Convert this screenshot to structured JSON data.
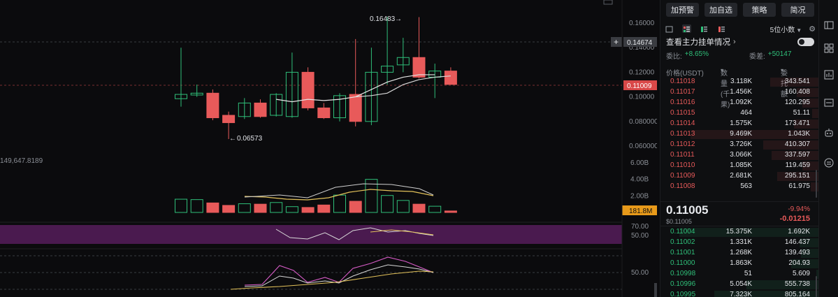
{
  "chart": {
    "top_left_fragment": "149,647.8189",
    "price_labels": [
      "0.16000",
      "0.14000",
      "0.12000",
      "0.10000",
      "0.080000",
      "0.060000"
    ],
    "price_marker_current": "0.14674",
    "price_marker_last": "0.11009",
    "high_annotation": "0.16483",
    "low_annotation": "0.06573",
    "volume_labels": [
      "6.00B",
      "4.00B",
      "2.00B"
    ],
    "volume_marker": "181.8M",
    "indicator1_labels": [
      "70.00",
      "50.00"
    ],
    "indicator2_labels": [
      "50.00"
    ],
    "colors": {
      "up": "#2fbf79",
      "down": "#e85a5a",
      "band": "#4a1a4f",
      "marker": "#e89a1a"
    }
  },
  "chart_data": {
    "type": "candlestick",
    "candles": [
      {
        "o": 0.0985,
        "h": 0.14,
        "l": 0.092,
        "c": 0.102
      },
      {
        "o": 0.1015,
        "h": 0.11,
        "l": 0.1,
        "c": 0.103
      },
      {
        "o": 0.103,
        "h": 0.106,
        "l": 0.081,
        "c": 0.083
      },
      {
        "o": 0.085,
        "h": 0.088,
        "l": 0.0657,
        "c": 0.079
      },
      {
        "o": 0.084,
        "h": 0.099,
        "l": 0.082,
        "c": 0.095
      },
      {
        "o": 0.095,
        "h": 0.098,
        "l": 0.083,
        "c": 0.084
      },
      {
        "o": 0.085,
        "h": 0.103,
        "l": 0.084,
        "c": 0.102
      },
      {
        "o": 0.084,
        "h": 0.136,
        "l": 0.083,
        "c": 0.12
      },
      {
        "o": 0.12,
        "h": 0.124,
        "l": 0.089,
        "c": 0.091
      },
      {
        "o": 0.091,
        "h": 0.095,
        "l": 0.082,
        "c": 0.083
      },
      {
        "o": 0.083,
        "h": 0.103,
        "l": 0.08,
        "c": 0.101
      },
      {
        "o": 0.102,
        "h": 0.147,
        "l": 0.076,
        "c": 0.08
      },
      {
        "o": 0.08,
        "h": 0.14,
        "l": 0.077,
        "c": 0.12
      },
      {
        "o": 0.12,
        "h": 0.165,
        "l": 0.11,
        "c": 0.125
      },
      {
        "o": 0.126,
        "h": 0.148,
        "l": 0.12,
        "c": 0.132
      },
      {
        "o": 0.132,
        "h": 0.1648,
        "l": 0.115,
        "c": 0.116
      },
      {
        "o": 0.116,
        "h": 0.127,
        "l": 0.099,
        "c": 0.121
      },
      {
        "o": 0.121,
        "h": 0.124,
        "l": 0.11,
        "c": 0.1101
      }
    ],
    "ma_short": [
      0.098,
      0.096,
      0.098,
      0.097,
      0.098,
      0.1,
      0.106,
      0.112,
      0.116,
      0.118,
      0.118
    ],
    "ma_long": [
      0.1,
      0.101,
      0.103,
      0.11,
      0.114,
      0.116,
      0.117
    ],
    "volumes": [
      1.6,
      1.55,
      1.15,
      0.85,
      1.05,
      1.0,
      1.2,
      0.7,
      0.6,
      0.9,
      2.1,
      1.35,
      4.0,
      2.05,
      1.45,
      1.0,
      0.75,
      0.18
    ],
    "ylim": [
      0.05,
      0.175
    ],
    "volume_ylim": [
      0,
      6.5
    ]
  },
  "orderbook": {
    "buttons": [
      "加预警",
      "加自选",
      "策略",
      "简况"
    ],
    "precision": "5位小数",
    "pending_title": "查看主力挂单情况",
    "ratio_label": "委比:",
    "ratio_value": "+8.65%",
    "diff_label": "委差:",
    "diff_value": "+50147",
    "col_price": "价格(USDT)",
    "col_qty": "数量 (千果)",
    "col_total": "委托额",
    "asks": [
      {
        "price": "0.11018",
        "qty": "3.118K",
        "total": "343.541",
        "depth": 0.35
      },
      {
        "price": "0.11017",
        "qty": "1.456K",
        "total": "160.408",
        "depth": 0.16
      },
      {
        "price": "0.11016",
        "qty": "1.092K",
        "total": "120.295",
        "depth": 0.12
      },
      {
        "price": "0.11015",
        "qty": "464",
        "total": "51.11",
        "depth": 0.05
      },
      {
        "price": "0.11014",
        "qty": "1.575K",
        "total": "173.471",
        "depth": 0.18
      },
      {
        "price": "0.11013",
        "qty": "9.469K",
        "total": "1.043K",
        "depth": 0.92
      },
      {
        "price": "0.11012",
        "qty": "3.726K",
        "total": "410.307",
        "depth": 0.4
      },
      {
        "price": "0.11011",
        "qty": "3.066K",
        "total": "337.597",
        "depth": 0.34
      },
      {
        "price": "0.11010",
        "qty": "1.085K",
        "total": "119.459",
        "depth": 0.12
      },
      {
        "price": "0.11009",
        "qty": "2.681K",
        "total": "295.151",
        "depth": 0.3
      },
      {
        "price": "0.11008",
        "qty": "563",
        "total": "61.975",
        "depth": 0.06
      }
    ],
    "last_price": "0.11005",
    "last_usd": "$0.11005",
    "last_pct": "-9.94%",
    "last_change": "-0.01215",
    "bids": [
      {
        "price": "0.11004",
        "qty": "15.375K",
        "total": "1.692K",
        "depth": 1.0
      },
      {
        "price": "0.11002",
        "qty": "1.331K",
        "total": "146.437",
        "depth": 0.14
      },
      {
        "price": "0.11001",
        "qty": "1.268K",
        "total": "139.493",
        "depth": 0.13
      },
      {
        "price": "0.11000",
        "qty": "1.863K",
        "total": "204.93",
        "depth": 0.2
      },
      {
        "price": "0.10998",
        "qty": "51",
        "total": "5.609",
        "depth": 0.02
      },
      {
        "price": "0.10996",
        "qty": "5.054K",
        "total": "555.738",
        "depth": 0.52
      },
      {
        "price": "0.10995",
        "qty": "7.323K",
        "total": "805.164",
        "depth": 0.75
      }
    ]
  }
}
